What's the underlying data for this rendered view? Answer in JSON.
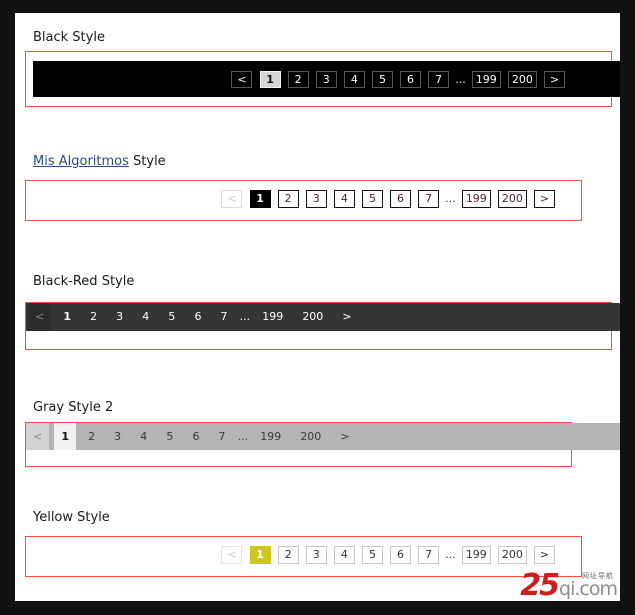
{
  "page": {
    "background": "#111111",
    "canvas_background": "#ffffff",
    "frame_border_color": "#f4503c"
  },
  "sections": [
    {
      "id": "black",
      "title": "Black Style",
      "title_link": null,
      "title_suffix": null,
      "bar_background": "#000000",
      "active_page": "1",
      "items": [
        {
          "label": "<",
          "state": "normal"
        },
        {
          "label": "1",
          "state": "active"
        },
        {
          "label": "2",
          "state": "normal"
        },
        {
          "label": "3",
          "state": "normal"
        },
        {
          "label": "4",
          "state": "normal"
        },
        {
          "label": "5",
          "state": "normal"
        },
        {
          "label": "6",
          "state": "normal"
        },
        {
          "label": "7",
          "state": "normal"
        },
        {
          "label": "...",
          "state": "ellipsis"
        },
        {
          "label": "199",
          "state": "normal"
        },
        {
          "label": "200",
          "state": "normal"
        },
        {
          "label": ">",
          "state": "normal"
        }
      ]
    },
    {
      "id": "mis",
      "title": "Mis Algoritmos",
      "title_link": "Mis Algoritmos",
      "title_suffix": " Style",
      "bar_background": "#ffffff",
      "active_page": "1",
      "items": [
        {
          "label": "<",
          "state": "disabled"
        },
        {
          "label": "1",
          "state": "active"
        },
        {
          "label": "2",
          "state": "normal"
        },
        {
          "label": "3",
          "state": "normal"
        },
        {
          "label": "4",
          "state": "normal"
        },
        {
          "label": "5",
          "state": "normal"
        },
        {
          "label": "6",
          "state": "normal"
        },
        {
          "label": "7",
          "state": "normal"
        },
        {
          "label": "...",
          "state": "ellipsis"
        },
        {
          "label": "199",
          "state": "normal"
        },
        {
          "label": "200",
          "state": "normal"
        },
        {
          "label": ">",
          "state": "normal"
        }
      ]
    },
    {
      "id": "blackred",
      "title": "Black-Red Style",
      "title_link": null,
      "title_suffix": null,
      "bar_background": "#353535",
      "active_page": "1",
      "items": [
        {
          "label": "<",
          "state": "disabled"
        },
        {
          "label": "1",
          "state": "active"
        },
        {
          "label": "2",
          "state": "normal"
        },
        {
          "label": "3",
          "state": "normal"
        },
        {
          "label": "4",
          "state": "normal"
        },
        {
          "label": "5",
          "state": "normal"
        },
        {
          "label": "6",
          "state": "normal"
        },
        {
          "label": "7",
          "state": "normal"
        },
        {
          "label": "...",
          "state": "ellipsis"
        },
        {
          "label": "199",
          "state": "normal"
        },
        {
          "label": "200",
          "state": "normal"
        },
        {
          "label": ">",
          "state": "normal"
        }
      ]
    },
    {
      "id": "gray",
      "title": "Gray Style 2",
      "title_link": null,
      "title_suffix": null,
      "bar_background": "#b4b4b4",
      "active_page": "1",
      "items": [
        {
          "label": "<",
          "state": "disabled"
        },
        {
          "label": "1",
          "state": "active"
        },
        {
          "label": "2",
          "state": "normal"
        },
        {
          "label": "3",
          "state": "normal"
        },
        {
          "label": "4",
          "state": "normal"
        },
        {
          "label": "5",
          "state": "normal"
        },
        {
          "label": "6",
          "state": "normal"
        },
        {
          "label": "7",
          "state": "normal"
        },
        {
          "label": "...",
          "state": "ellipsis"
        },
        {
          "label": "199",
          "state": "normal"
        },
        {
          "label": "200",
          "state": "normal"
        },
        {
          "label": ">",
          "state": "normal"
        }
      ]
    },
    {
      "id": "yellow",
      "title": "Yellow Style",
      "title_link": null,
      "title_suffix": null,
      "bar_background": "#ffffff",
      "active_color": "#cec81d",
      "active_page": "1",
      "items": [
        {
          "label": "<",
          "state": "disabled"
        },
        {
          "label": "1",
          "state": "active"
        },
        {
          "label": "2",
          "state": "normal"
        },
        {
          "label": "3",
          "state": "normal"
        },
        {
          "label": "4",
          "state": "normal"
        },
        {
          "label": "5",
          "state": "normal"
        },
        {
          "label": "6",
          "state": "normal"
        },
        {
          "label": "7",
          "state": "normal"
        },
        {
          "label": "...",
          "state": "ellipsis"
        },
        {
          "label": "199",
          "state": "normal"
        },
        {
          "label": "200",
          "state": "normal"
        },
        {
          "label": ">",
          "state": "normal"
        }
      ]
    }
  ],
  "watermark": {
    "mark": "25",
    "domain": "qi.com",
    "tagline": "网址导航",
    "mark_color": "#cf1d1d",
    "domain_color": "#8d8d8d"
  }
}
